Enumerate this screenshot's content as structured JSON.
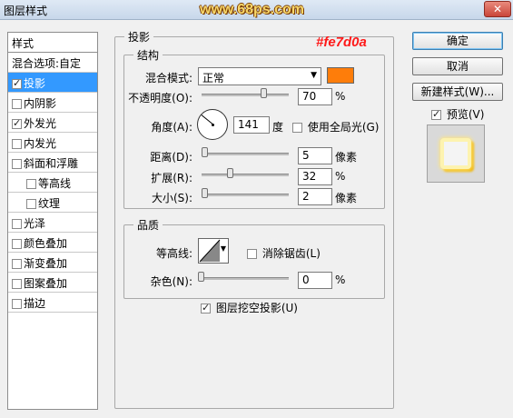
{
  "window": {
    "title": "图层样式",
    "watermark": "www.68ps.com",
    "close_glyph": "✕"
  },
  "styles_panel": {
    "header": "样式",
    "items": [
      {
        "label": "混合选项:自定",
        "has_checkbox": false,
        "checked": false,
        "selected": false,
        "indent": false
      },
      {
        "label": "投影",
        "has_checkbox": true,
        "checked": true,
        "selected": true,
        "indent": false
      },
      {
        "label": "内阴影",
        "has_checkbox": true,
        "checked": false,
        "selected": false,
        "indent": false
      },
      {
        "label": "外发光",
        "has_checkbox": true,
        "checked": true,
        "selected": false,
        "indent": false
      },
      {
        "label": "内发光",
        "has_checkbox": true,
        "checked": false,
        "selected": false,
        "indent": false
      },
      {
        "label": "斜面和浮雕",
        "has_checkbox": true,
        "checked": false,
        "selected": false,
        "indent": false
      },
      {
        "label": "等高线",
        "has_checkbox": true,
        "checked": false,
        "selected": false,
        "indent": true
      },
      {
        "label": "纹理",
        "has_checkbox": true,
        "checked": false,
        "selected": false,
        "indent": true
      },
      {
        "label": "光泽",
        "has_checkbox": true,
        "checked": false,
        "selected": false,
        "indent": false
      },
      {
        "label": "颜色叠加",
        "has_checkbox": true,
        "checked": false,
        "selected": false,
        "indent": false
      },
      {
        "label": "渐变叠加",
        "has_checkbox": true,
        "checked": false,
        "selected": false,
        "indent": false
      },
      {
        "label": "图案叠加",
        "has_checkbox": true,
        "checked": false,
        "selected": false,
        "indent": false
      },
      {
        "label": "描边",
        "has_checkbox": true,
        "checked": false,
        "selected": false,
        "indent": false
      }
    ]
  },
  "drop_shadow": {
    "title": "投影",
    "color_annotation": "#fe7d0a",
    "structure": {
      "title": "结构",
      "blend_mode_label": "混合模式:",
      "blend_mode_value": "正常",
      "shadow_color": "#fe7d0a",
      "opacity_label": "不透明度(O):",
      "opacity_value": "70",
      "opacity_unit": "%",
      "angle_label": "角度(A):",
      "angle_value": "141",
      "angle_unit": "度",
      "global_light_label": "使用全局光(G)",
      "global_light_checked": false,
      "distance_label": "距离(D):",
      "distance_value": "5",
      "distance_unit": "像素",
      "spread_label": "扩展(R):",
      "spread_value": "32",
      "spread_unit": "%",
      "size_label": "大小(S):",
      "size_value": "2",
      "size_unit": "像素"
    },
    "quality": {
      "title": "品质",
      "contour_label": "等高线:",
      "anti_alias_label": "消除锯齿(L)",
      "anti_alias_checked": false,
      "noise_label": "杂色(N):",
      "noise_value": "0",
      "noise_unit": "%"
    },
    "knockout_label": "图层挖空投影(U)",
    "knockout_checked": true
  },
  "buttons": {
    "ok": "确定",
    "cancel": "取消",
    "new_style": "新建样式(W)...",
    "preview_label": "预览(V)",
    "preview_checked": true
  },
  "colors": {
    "selected": "#3399ff",
    "annotation": "#fe1a1a",
    "swatch": "#fe7d0a"
  }
}
